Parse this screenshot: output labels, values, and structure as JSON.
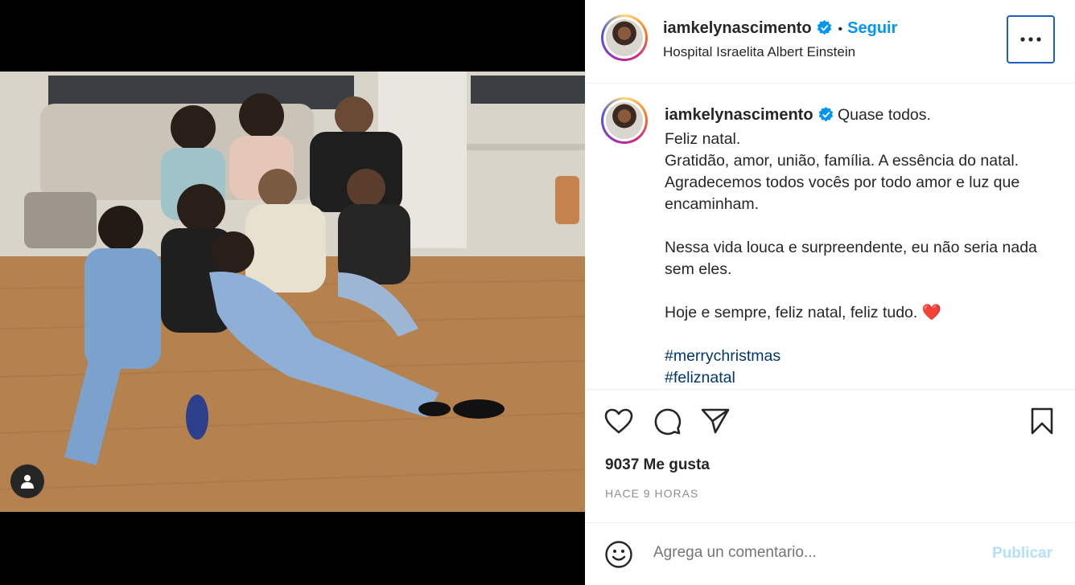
{
  "post": {
    "username": "iamkelynascimento",
    "follow_label": "Seguir",
    "separator": "•",
    "location": "Hospital Israelita Albert Einstein",
    "caption_lines": [
      "Quase todos.",
      "Feliz natal.",
      "Gratidão, amor, união, família. A essência do natal. Agradecemos todos vocês por todo amor e luz que encaminham.",
      "",
      "Nessa vida louca e surpreendente, eu não seria nada sem eles.",
      "",
      "Hoje e sempre, feliz natal, feliz tudo. ❤️",
      ""
    ],
    "hashtags": [
      "#merrychristmas",
      "#feliznatal"
    ],
    "likes": "9037 Me gusta",
    "time_ago": "HACE 9 HORAS"
  },
  "comment": {
    "placeholder": "Agrega un comentario...",
    "publish_label": "Publicar"
  },
  "icons": {
    "verified": "verified-badge-icon",
    "more": "more-options-icon",
    "like": "heart-icon",
    "comment": "comment-bubble-icon",
    "share": "paper-plane-icon",
    "save": "bookmark-icon",
    "emoji": "emoji-icon",
    "tag": "user-tag-icon"
  },
  "colors": {
    "accent": "#0095f6",
    "hashtag": "#00376b",
    "muted": "#8e8e8e",
    "publish_disabled": "#b2dffc"
  }
}
